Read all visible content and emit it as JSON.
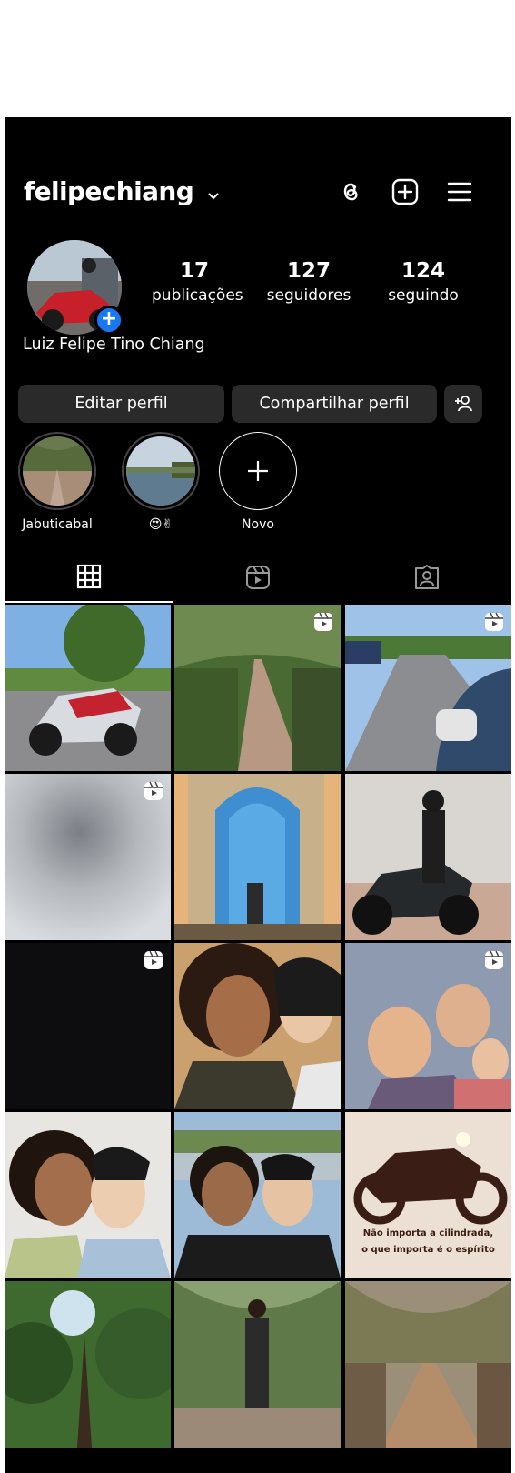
{
  "profile": {
    "username": "felipechiang",
    "full_name": "Luiz Felipe Tino Chiang",
    "stats": [
      {
        "value": "17",
        "label": "publicações"
      },
      {
        "value": "127",
        "label": "seguidores"
      },
      {
        "value": "124",
        "label": "seguindo"
      }
    ]
  },
  "topbar": {
    "icons": [
      "threads-icon",
      "new-post-icon",
      "menu-icon"
    ]
  },
  "buttons": {
    "edit": "Editar perfil",
    "share": "Compartilhar perfil",
    "add_person": "+person-icon"
  },
  "highlights": [
    {
      "label": "Jabuticabal"
    },
    {
      "label": "😍✌"
    },
    {
      "label": "Novo"
    }
  ],
  "tabs": [
    "grid-icon",
    "reels-icon",
    "tagged-icon"
  ],
  "posts": [
    {
      "id": 1,
      "reel": false,
      "desc": "motorcycle by lake"
    },
    {
      "id": 2,
      "reel": true,
      "desc": "dirt path in forest"
    },
    {
      "id": 3,
      "reel": true,
      "desc": "road with helmet"
    },
    {
      "id": 4,
      "reel": true,
      "desc": "blurry grey"
    },
    {
      "id": 5,
      "reel": false,
      "desc": "blue door couple"
    },
    {
      "id": 6,
      "reel": false,
      "desc": "rider on motorcycle"
    },
    {
      "id": 7,
      "reel": true,
      "desc": "dark"
    },
    {
      "id": 8,
      "reel": false,
      "desc": "selfie couple"
    },
    {
      "id": 9,
      "reel": true,
      "desc": "family photo"
    },
    {
      "id": 10,
      "reel": false,
      "desc": "couple selfie"
    },
    {
      "id": 11,
      "reel": false,
      "desc": "couple selfie outdoors"
    },
    {
      "id": 12,
      "reel": false,
      "desc": "motorcycle silhouette"
    },
    {
      "id": 13,
      "reel": false,
      "desc": "tree canopy"
    },
    {
      "id": 14,
      "reel": false,
      "desc": "couple under trees"
    },
    {
      "id": 15,
      "reel": false,
      "desc": "tree tunnel"
    }
  ],
  "caption_post12": {
    "line1": "Não importa a cilindrada,",
    "line2": "o que importa é o espírito"
  },
  "colors": {
    "accent": "#1877f2",
    "bg": "#000000",
    "button": "#2a2a2a"
  }
}
